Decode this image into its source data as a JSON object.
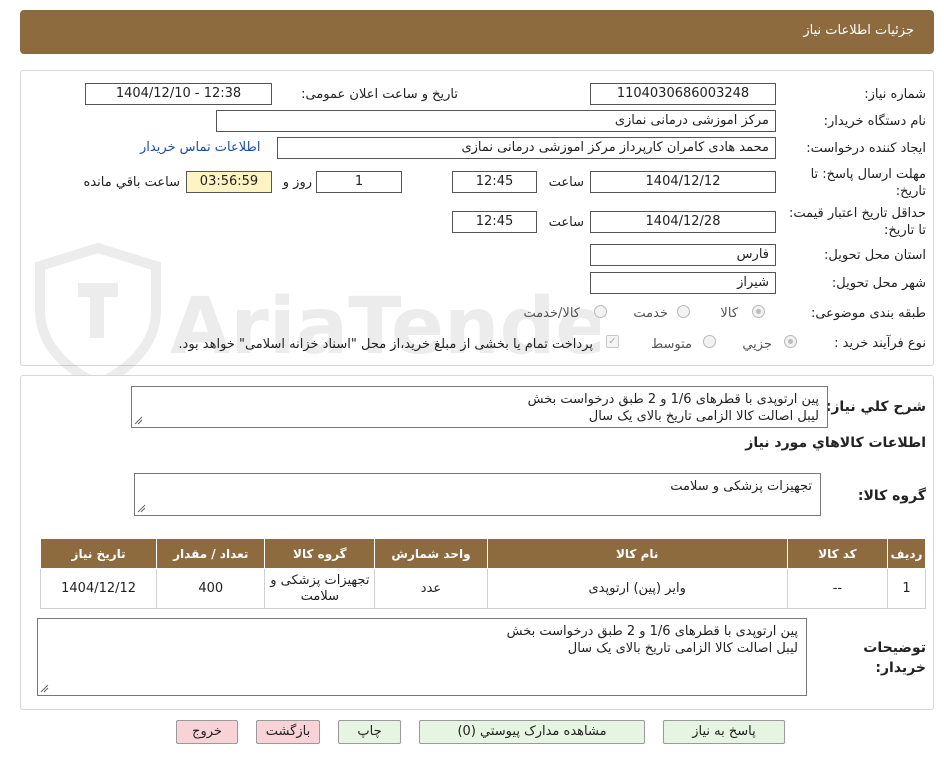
{
  "header": {
    "title": "جزئیات اطلاعات نیاز"
  },
  "fields": {
    "need_number_label": "شماره نیاز:",
    "need_number": "1104030686003248",
    "announce_label": "تاریخ و ساعت اعلان عمومی:",
    "announce_value": "1404/12/10 - 12:38",
    "buyer_org_label": "نام دستگاه خریدار:",
    "buyer_org": "مرکز اموزشی درمانی نمازی",
    "requester_label": "ایجاد کننده درخواست:",
    "requester": "محمد هادی کامران کارپرداز مرکز اموزشی درمانی نمازی",
    "contact_link": "اطلاعات تماس خریدار",
    "deadline_label": "مهلت ارسال پاسخ: تا تاریخ:",
    "deadline_date": "1404/12/12",
    "time_label": "ساعت",
    "deadline_time": "12:45",
    "days_value": "1",
    "days_label": "روز و",
    "remaining_time": "03:56:59",
    "remaining_label": "ساعت باقي مانده",
    "validity_label": "حداقل تاریخ اعتبار قیمت: تا تاریخ:",
    "validity_date": "1404/12/28",
    "validity_time": "12:45",
    "province_label": "استان محل تحویل:",
    "province": "فارس",
    "city_label": "شهر محل تحویل:",
    "city": "شیراز",
    "category_label": "طبقه بندی موضوعی:",
    "category_options": [
      "کالا",
      "خدمت",
      "کالا/خدمت"
    ],
    "process_label": "نوع فرآیند خرید :",
    "process_options": [
      "جزیي",
      "متوسط"
    ],
    "payment_note": "پرداخت تمام یا بخشی از مبلغ خرید،از محل \"اسناد خزانه اسلامی\" خواهد بود."
  },
  "summary": {
    "label": "شرح كلي نياز:",
    "lines": [
      "پین ارتوپدی با قطرهای 1/6 و 2 طبق درخواست بخش",
      "لیبل اصالت کالا الزامی تاریخ بالای یک سال"
    ]
  },
  "goods_section": {
    "title": "اطلاعات کالاهاي مورد نياز",
    "group_label": "گروه کالا:",
    "group_value": "تجهیزات پزشکی و سلامت"
  },
  "table": {
    "headers": [
      "رديف",
      "کد کالا",
      "نام کالا",
      "واحد شمارش",
      "گروه کالا",
      "تعداد / مقدار",
      "تاریخ نیاز"
    ],
    "rows": [
      [
        "1",
        "--",
        "وایر (پین) ارتوپدی",
        "عدد",
        "تجهیزات پزشکی و سلامت",
        "400",
        "1404/12/12"
      ]
    ]
  },
  "buyer_notes": {
    "label": "توضيحات خريدار:",
    "lines": [
      "پین ارتوپدی با قطرهای 1/6 و 2 طبق درخواست بخش",
      "لیبل اصالت کالا الزامی تاریخ بالای یک سال"
    ]
  },
  "buttons": {
    "reply": "پاسخ به نیاز",
    "attachments": "مشاهده مدارک پیوستي (0)",
    "print": "چاپ",
    "back": "بازگشت",
    "exit": "خروج"
  },
  "watermark": {
    "text": "AriaTender.neT"
  }
}
